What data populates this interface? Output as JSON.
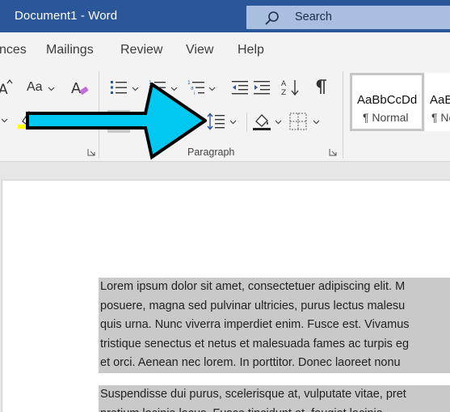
{
  "titlebar": {
    "title": "Document1 - Word",
    "search_placeholder": "Search"
  },
  "menu": {
    "tabs": [
      {
        "label": "nces"
      },
      {
        "label": "Mailings"
      },
      {
        "label": "Review"
      },
      {
        "label": "View"
      },
      {
        "label": "Help"
      }
    ]
  },
  "ribbon": {
    "paragraph_group_label": "Paragraph",
    "font_case_label": "Aa",
    "styles": [
      {
        "sample": "AaBbCcDd",
        "name": "¶ Normal"
      },
      {
        "sample": "AaBbCcDd",
        "name": "¶ No Spacing"
      }
    ]
  },
  "document": {
    "paragraphs": [
      [
        "Lorem ipsum dolor sit amet, consectetuer adipiscing elit. M",
        "posuere, magna sed pulvinar ultricies, purus lectus malesu",
        "quis urna. Nunc viverra imperdiet enim. Fusce est. Vivamus",
        "tristique senectus et netus et malesuada fames ac turpis eg",
        "et orci. Aenean nec lorem. In porttitor. Donec laoreet nonu"
      ],
      [
        "Suspendisse dui purus, scelerisque at, vulputate vitae, pret",
        "pretium lacinia lacus. Fusce tincidunt et, feugiat lacinia"
      ]
    ]
  },
  "colors": {
    "title_bar": "#2b579a",
    "highlight_yellow": "#ffff00",
    "font_red": "#e00000",
    "annotation_arrow": "#00c8f0",
    "selection": "#c9c9c9"
  }
}
